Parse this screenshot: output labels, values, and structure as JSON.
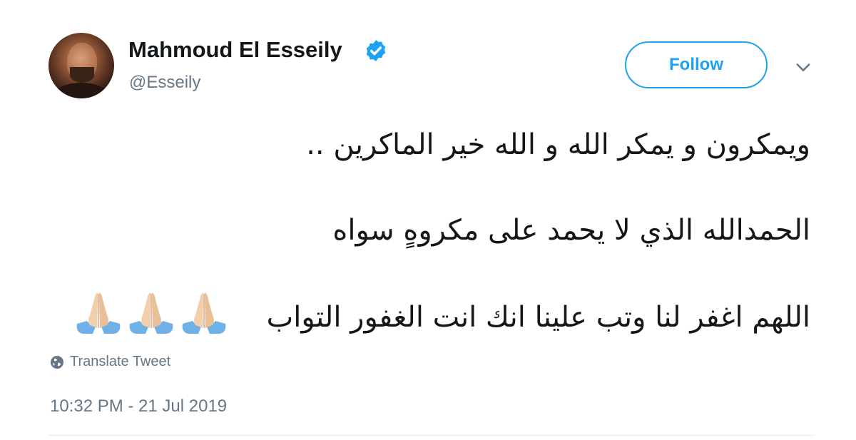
{
  "author": {
    "name": "Mahmoud El Esseily",
    "handle": "@Esseily",
    "verified": true
  },
  "follow_label": "Follow",
  "tweet": {
    "lines": [
      "ويمكرون و يمكر الله و الله خير الماكرين ..",
      "الحمدالله الذي لا يحمد على مكروهٍ سواه",
      "اللهم اغفر لنا وتب علينا انك انت الغفور التواب"
    ],
    "emojis": [
      "folded-hands",
      "folded-hands",
      "folded-hands"
    ]
  },
  "translate_label": "Translate Tweet",
  "timestamp": "10:32 PM - 21 Jul 2019",
  "colors": {
    "accent": "#1da1f2",
    "secondary_text": "#657786",
    "primary_text": "#14171a"
  },
  "icons": {
    "verified": "verified-badge-icon",
    "more": "chevron-down-icon",
    "translate": "globe-icon"
  }
}
